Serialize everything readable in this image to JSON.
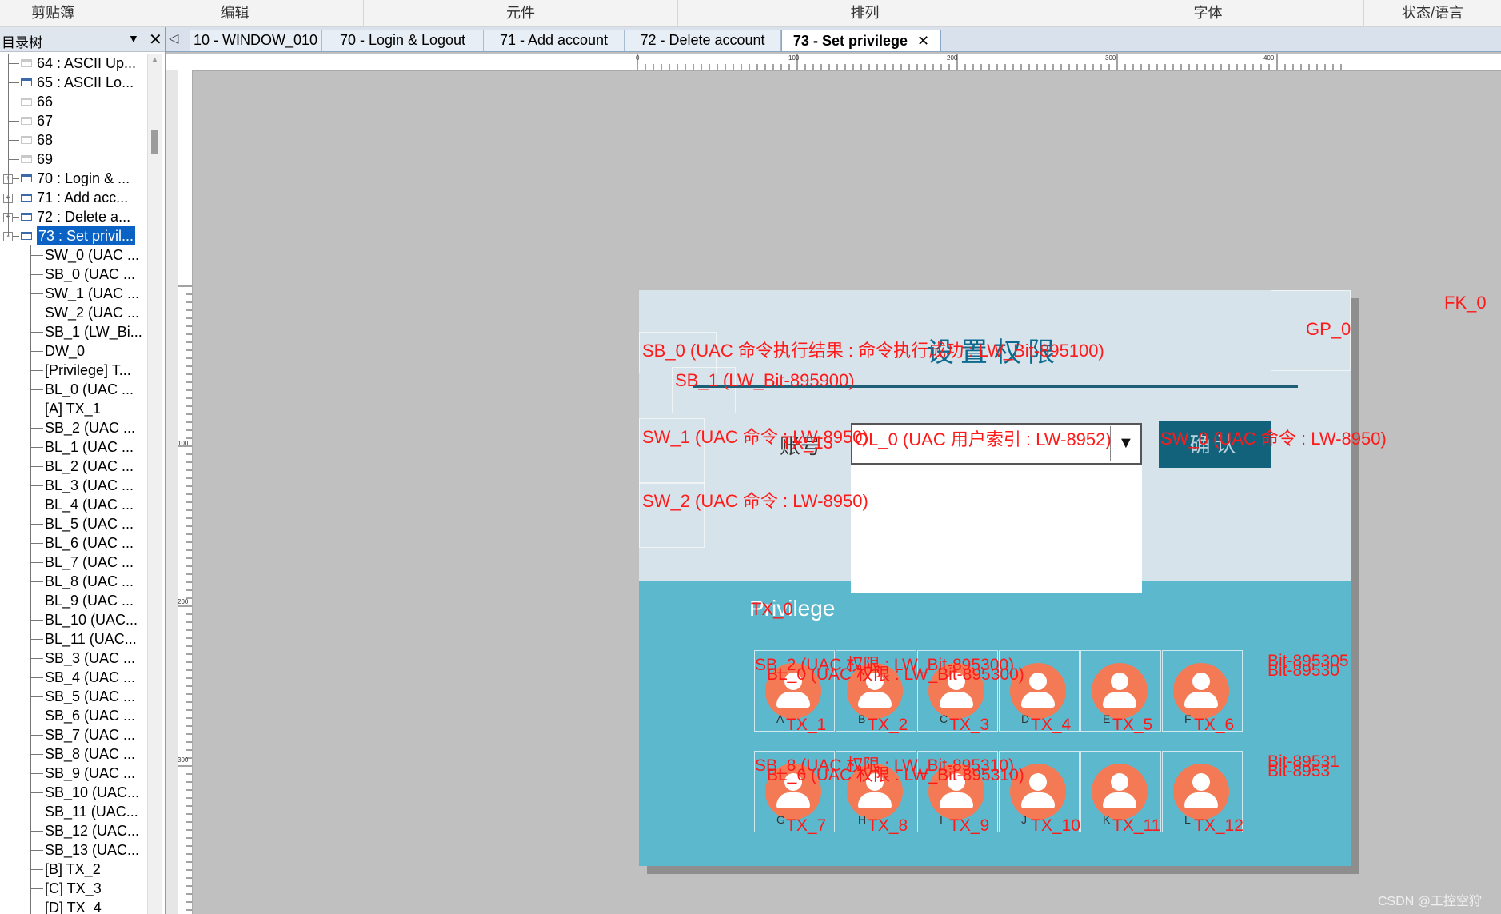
{
  "ribbon": {
    "groups": [
      "剪贴簿",
      "编辑",
      "元件",
      "排列",
      "字体",
      "状态/语言"
    ]
  },
  "tree": {
    "title": "目录树",
    "items": [
      {
        "label": "64 : ASCII Up...",
        "kind": "window",
        "gray": true
      },
      {
        "label": "65 : ASCII Lo...",
        "kind": "window",
        "gray": false
      },
      {
        "label": "66",
        "kind": "window",
        "gray": true
      },
      {
        "label": "67",
        "kind": "window",
        "gray": true
      },
      {
        "label": "68",
        "kind": "window",
        "gray": true
      },
      {
        "label": "69",
        "kind": "window",
        "gray": true
      },
      {
        "label": "70 : Login & ...",
        "kind": "window",
        "expand": "+"
      },
      {
        "label": "71 : Add acc...",
        "kind": "window",
        "expand": "+"
      },
      {
        "label": "72 : Delete a...",
        "kind": "window",
        "expand": "+"
      },
      {
        "label": "73 : Set privil...",
        "kind": "window",
        "expand": "-",
        "selected": true
      },
      {
        "label": "SW_0 (UAC ...",
        "kind": "child"
      },
      {
        "label": "SB_0 (UAC ...",
        "kind": "child"
      },
      {
        "label": "SW_1 (UAC ...",
        "kind": "child"
      },
      {
        "label": "SW_2 (UAC ...",
        "kind": "child"
      },
      {
        "label": "SB_1 (LW_Bi...",
        "kind": "child"
      },
      {
        "label": "DW_0",
        "kind": "child"
      },
      {
        "label": "[Privilege] T...",
        "kind": "child"
      },
      {
        "label": "BL_0 (UAC ...",
        "kind": "child"
      },
      {
        "label": "[A] TX_1",
        "kind": "child"
      },
      {
        "label": "SB_2 (UAC ...",
        "kind": "child"
      },
      {
        "label": "BL_1 (UAC ...",
        "kind": "child"
      },
      {
        "label": "BL_2 (UAC ...",
        "kind": "child"
      },
      {
        "label": "BL_3 (UAC ...",
        "kind": "child"
      },
      {
        "label": "BL_4 (UAC ...",
        "kind": "child"
      },
      {
        "label": "BL_5 (UAC ...",
        "kind": "child"
      },
      {
        "label": "BL_6 (UAC ...",
        "kind": "child"
      },
      {
        "label": "BL_7 (UAC ...",
        "kind": "child"
      },
      {
        "label": "BL_8 (UAC ...",
        "kind": "child"
      },
      {
        "label": "BL_9 (UAC ...",
        "kind": "child"
      },
      {
        "label": "BL_10 (UAC...",
        "kind": "child"
      },
      {
        "label": "BL_11 (UAC...",
        "kind": "child"
      },
      {
        "label": "SB_3 (UAC ...",
        "kind": "child"
      },
      {
        "label": "SB_4 (UAC ...",
        "kind": "child"
      },
      {
        "label": "SB_5 (UAC ...",
        "kind": "child"
      },
      {
        "label": "SB_6 (UAC ...",
        "kind": "child"
      },
      {
        "label": "SB_7 (UAC ...",
        "kind": "child"
      },
      {
        "label": "SB_8 (UAC ...",
        "kind": "child"
      },
      {
        "label": "SB_9 (UAC ...",
        "kind": "child"
      },
      {
        "label": "SB_10 (UAC...",
        "kind": "child"
      },
      {
        "label": "SB_11 (UAC...",
        "kind": "child"
      },
      {
        "label": "SB_12 (UAC...",
        "kind": "child"
      },
      {
        "label": "SB_13 (UAC...",
        "kind": "child"
      },
      {
        "label": "[B] TX_2",
        "kind": "child"
      },
      {
        "label": "[C] TX_3",
        "kind": "child"
      },
      {
        "label": "[D] TX_4",
        "kind": "child"
      }
    ]
  },
  "tabs": [
    {
      "label": "10 - WINDOW_010"
    },
    {
      "label": "70 - Login & Logout"
    },
    {
      "label": "71 - Add account"
    },
    {
      "label": "72 - Delete account"
    },
    {
      "label": "73 - Set privilege",
      "active": true
    }
  ],
  "ruler": {
    "h_labels": [
      "0",
      "100",
      "200",
      "300",
      "400"
    ],
    "v_labels": [
      "100",
      "200",
      "300"
    ]
  },
  "screen": {
    "title": "设置权限",
    "name_label": "账号",
    "confirm_label": "确认",
    "privilege_label": "Privilege",
    "object_labels": {
      "fk0": "FK_0",
      "gp0": "GP_0",
      "sb0": "SB_0 (UAC 命令执行结果 : 命令执行成功 : LW_Bit-895100)",
      "sb1": "SB_1 (LW_Bit-895900)",
      "sw1": "SW_1 (UAC 命令 : LW-8950)",
      "tx13": "TX_13",
      "ol0": "OL_0 (UAC 用户索引 : LW-8952)",
      "sw0": "SW_0 (UAC 命令 : LW-8950)",
      "sw2": "SW_2 (UAC 命令 : LW-8950)",
      "tx0": "TX_0",
      "row1_sb": "SB_2 (UAC 权限 : LW_Bit-895300)",
      "row1_bl": "BL_0 (UAC 权限 : LW_Bit-895300)",
      "row1_tail_top": "Bit-895305",
      "row1_tail_bot": "Bit-89530",
      "row2_sb": "SB_8 (UAC 权限 : LW_Bit-895310)",
      "row2_bl": "BL_6 (UAC 权限 : LW_Bit-895310)",
      "row2_tail_top": "Bit-89531",
      "row2_tail_bot": "Bit-8953"
    },
    "row1": [
      {
        "letter": "A",
        "tx": "TX_1"
      },
      {
        "letter": "B",
        "tx": "TX_2"
      },
      {
        "letter": "C",
        "tx": "TX_3"
      },
      {
        "letter": "D",
        "tx": "TX_4"
      },
      {
        "letter": "E",
        "tx": "TX_5"
      },
      {
        "letter": "F",
        "tx": "TX_6"
      }
    ],
    "row2": [
      {
        "letter": "G",
        "tx": "TX_7"
      },
      {
        "letter": "H",
        "tx": "TX_8"
      },
      {
        "letter": "I",
        "tx": "TX_9"
      },
      {
        "letter": "J",
        "tx": "TX_10"
      },
      {
        "letter": "K",
        "tx": "TX_11"
      },
      {
        "letter": "L",
        "tx": "TX_12"
      }
    ],
    "colors": {
      "label_red": "#ff1a1a",
      "top_bg": "#d7e3eb",
      "bottom_bg": "#5cb8cc",
      "avatar": "#f47a55",
      "button": "#13627c"
    }
  },
  "watermark": "CSDN @工控空狩"
}
